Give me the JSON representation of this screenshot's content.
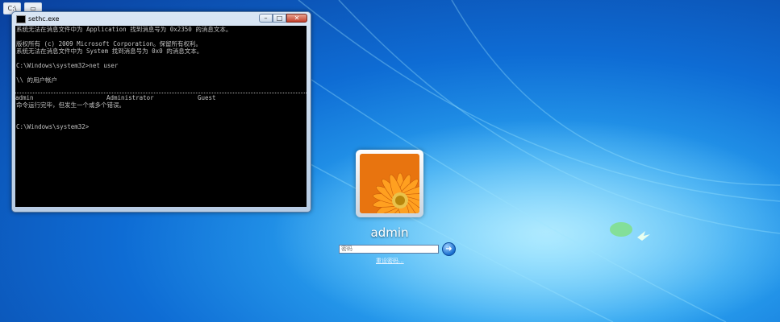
{
  "top_icons": [
    "C:\\",
    "▭"
  ],
  "window": {
    "title": "sethc.exe",
    "buttons": {
      "minimize": "–",
      "maximize": "□",
      "close": "✕"
    }
  },
  "console": {
    "lines": [
      "系统无法在消息文件中为 Application 找到消息号为 0x2350 的消息文本。",
      "",
      "版权所有 (c) 2009 Microsoft Corporation。保留所有权利。",
      "系统无法在消息文件中为 System 找到消息号为 0x0 的消息文本。",
      "",
      "C:\\Windows\\system32>net user",
      "",
      "\\\\ 的用户帐户",
      ""
    ],
    "users": [
      "admin",
      "Administrator",
      "Guest"
    ],
    "after": [
      "命令运行完毕，但发生一个或多个错误。",
      "",
      "",
      "C:\\Windows\\system32>"
    ]
  },
  "logon": {
    "username": "admin",
    "password_placeholder": "密码",
    "submit_icon": "arrow-right-icon",
    "reset_link": "重设密码..."
  }
}
